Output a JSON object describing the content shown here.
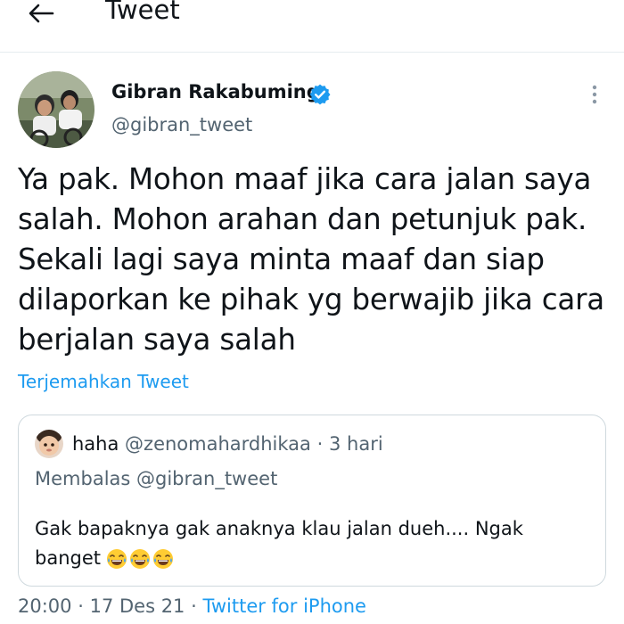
{
  "header": {
    "title": "Tweet",
    "back_icon": "arrow-left-icon"
  },
  "author": {
    "name": "Gibran Rakabuming",
    "handle": "@gibran_tweet",
    "verified_color": "#1d9bf0"
  },
  "tweet": {
    "lines": [
      "Ya pak. Mohon maaf jika cara jalan saya",
      "salah. Mohon arahan dan petunjuk pak.",
      "Sekali lagi saya minta maaf dan siap",
      "dilaporkan ke pihak yg berwajib jika cara",
      "berjalan saya salah"
    ],
    "translate_label": "Terjemahkan Tweet"
  },
  "quoted": {
    "name": "haha",
    "handle": "@zenomahardhikaa",
    "separator": "·",
    "time": "3 hari",
    "reply_line": "Membalas @gibran_tweet",
    "text_line1": "Gak bapaknya gak anaknya klau jalan dueh.... Ngak",
    "text_line2": "banget",
    "emojis": [
      "face-with-tears-of-joy-icon",
      "face-with-tears-of-joy-icon",
      "face-with-tears-of-joy-icon"
    ]
  },
  "footer": {
    "time": "20:00",
    "date": "17 Des 21",
    "source": "Twitter for iPhone",
    "separator": "·"
  },
  "colors": {
    "accent": "#1d9bf0",
    "text": "#0f1419",
    "muted": "#536471",
    "border": "#cfd9de"
  }
}
